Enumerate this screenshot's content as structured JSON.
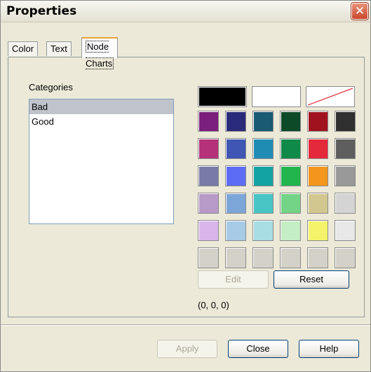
{
  "window": {
    "title": "Properties"
  },
  "tabs": [
    {
      "label": "Color",
      "active": false
    },
    {
      "label": "Text",
      "active": false
    },
    {
      "label": "Node Charts",
      "active": true
    }
  ],
  "categories": {
    "label": "Categories",
    "items": [
      {
        "label": "Bad",
        "selected": true
      },
      {
        "label": "Good",
        "selected": false
      }
    ]
  },
  "palette": {
    "special": [
      {
        "name": "black",
        "color": "#000000"
      },
      {
        "name": "white",
        "color": "#ffffff"
      },
      {
        "name": "no-color",
        "color": "none"
      }
    ],
    "rows": [
      [
        "#7b1f7c",
        "#2a2a7b",
        "#1b5a73",
        "#0d4a28",
        "#a0131e",
        "#303030"
      ],
      [
        "#b5327a",
        "#3f56b4",
        "#1f8cb4",
        "#108a48",
        "#e4293a",
        "#5e5e5e"
      ],
      [
        "#7a7aa6",
        "#5c6cf4",
        "#14a3a3",
        "#22b54e",
        "#f4951c",
        "#999999"
      ],
      [
        "#b89ac9",
        "#7da6d8",
        "#48c4c4",
        "#74d486",
        "#d2c78f",
        "#d4d4d4"
      ],
      [
        "#d8b6ec",
        "#a7cbe6",
        "#a8dde3",
        "#c4eec4",
        "#f4f36a",
        "#e8e8e8"
      ],
      [
        "#d4d2c8",
        "#d4d2c8",
        "#d4d2c8",
        "#d4d2c8",
        "#d4d2c8",
        "#d4d2c8"
      ]
    ],
    "current_rgb": "(0, 0, 0)"
  },
  "buttons": {
    "edit": "Edit",
    "reset": "Reset",
    "apply": "Apply",
    "close": "Close",
    "help": "Help"
  }
}
